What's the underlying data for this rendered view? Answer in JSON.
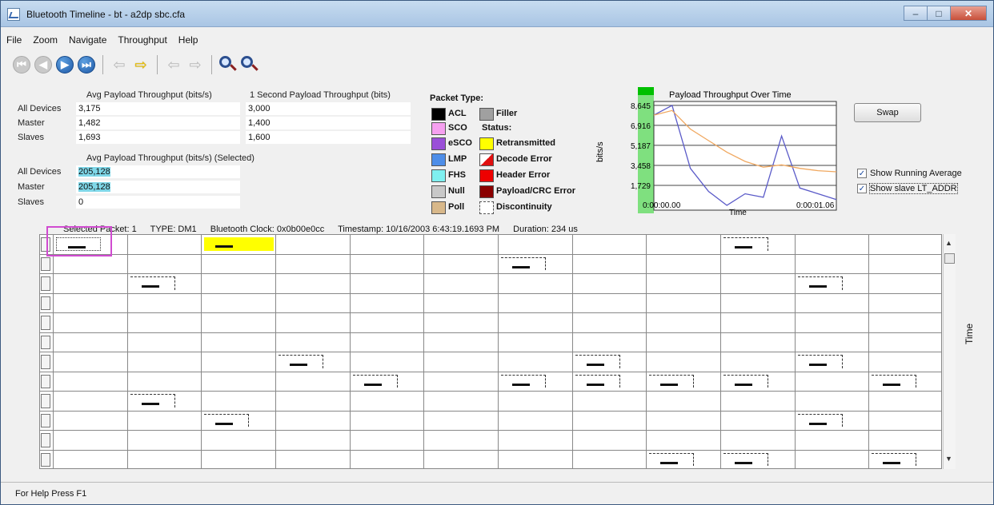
{
  "window": {
    "title": "Bluetooth Timeline - bt - a2dp sbc.cfa"
  },
  "menu": [
    "File",
    "Zoom",
    "Navigate",
    "Throughput",
    "Help"
  ],
  "toolbar": {
    "icons": [
      "first-icon",
      "prev-icon",
      "next-icon",
      "last-icon",
      "back-arrow-icon",
      "forward-arrow-icon",
      "back-arrow-icon",
      "forward-arrow-icon",
      "zoom-in-icon",
      "zoom-out-icon"
    ]
  },
  "throughput": {
    "avg_header": "Avg Payload Throughput (bits/s)",
    "sec_header": "1 Second Payload Throughput (bits)",
    "sel_header": "Avg Payload Throughput (bits/s) (Selected)",
    "rows": [
      {
        "label": "All Devices",
        "avg": "3,175",
        "sec": "3,000",
        "sel": "205,128"
      },
      {
        "label": "Master",
        "avg": "1,482",
        "sec": "1,400",
        "sel": "205,128"
      },
      {
        "label": "Slaves",
        "avg": "1,693",
        "sec": "1,600",
        "sel": "0"
      }
    ]
  },
  "legend": {
    "packet_type_title": "Packet Type:",
    "status_title": "Status:",
    "types": [
      {
        "label": "ACL",
        "color": "#000000"
      },
      {
        "label": "Filler",
        "color": "#a0a0a0"
      },
      {
        "label": "SCO",
        "color": "#f6a0f0"
      },
      {
        "label": "eSCO",
        "color": "#9a4fd8"
      },
      {
        "label": "LMP",
        "color": "#4e8ee8"
      },
      {
        "label": "FHS",
        "color": "#7ff0f0"
      },
      {
        "label": "Null",
        "color": "#c8c8c8"
      },
      {
        "label": "Poll",
        "color": "#d8b88a"
      }
    ],
    "statuses": [
      {
        "label": "Retransmitted",
        "color": "#ffff00"
      },
      {
        "label": "Decode Error",
        "color": "#e01010"
      },
      {
        "label": "Header Error",
        "color": "#ee0000"
      },
      {
        "label": "Payload/CRC Error",
        "color": "#8b0000"
      },
      {
        "label": "Discontinuity",
        "color": "#ffffff"
      }
    ]
  },
  "chart_data": {
    "type": "line",
    "title": "Payload Throughput Over Time",
    "ylabel": "bits/s",
    "xlabel": "Time",
    "yticks": [
      "8,645",
      "6,916",
      "5,187",
      "3,458",
      "1,729"
    ],
    "xticks": [
      "0:00:00.00",
      "0:00:01.06"
    ],
    "ylim": [
      0,
      8645
    ],
    "series": [
      {
        "color": "#5a5ac8",
        "x": [
          0,
          0.1,
          0.2,
          0.3,
          0.4,
          0.5,
          0.6,
          0.7,
          0.8,
          0.9,
          1.0
        ],
        "values": [
          7800,
          8645,
          3200,
          1200,
          0,
          1000,
          700,
          6000,
          1500,
          1000,
          500
        ]
      },
      {
        "color": "#f0a860",
        "x": [
          0,
          0.1,
          0.2,
          0.3,
          0.4,
          0.5,
          0.6,
          0.7,
          0.8,
          0.9,
          1.0
        ],
        "values": [
          7800,
          8200,
          6600,
          5600,
          4600,
          3800,
          3300,
          3500,
          3200,
          3000,
          2900
        ]
      }
    ]
  },
  "swap_label": "Swap",
  "options": {
    "show_running_average": "Show Running Average",
    "show_slave": "Show slave LT_ADDR"
  },
  "packet_info": {
    "selected": "Selected Packet: 1",
    "type": "TYPE: DM1",
    "clock": "Bluetooth Clock: 0x0b00e0cc",
    "timestamp": "Timestamp: 10/16/2003 6:43:19.1693 PM",
    "duration": "Duration: 234 us"
  },
  "timeline": {
    "rows": 12,
    "cols": 12,
    "time_label": "Time",
    "packets": [
      {
        "r": 0,
        "c": 0,
        "type": "sel"
      },
      {
        "r": 0,
        "c": 2,
        "type": "retx"
      },
      {
        "r": 0,
        "c": 9,
        "type": "box"
      },
      {
        "r": 1,
        "c": 6,
        "type": "box"
      },
      {
        "r": 2,
        "c": 1,
        "type": "box"
      },
      {
        "r": 2,
        "c": 10,
        "type": "box"
      },
      {
        "r": 6,
        "c": 3,
        "type": "box"
      },
      {
        "r": 6,
        "c": 7,
        "type": "box"
      },
      {
        "r": 6,
        "c": 10,
        "type": "box"
      },
      {
        "r": 7,
        "c": 4,
        "type": "box"
      },
      {
        "r": 7,
        "c": 6,
        "type": "box"
      },
      {
        "r": 7,
        "c": 7,
        "type": "box"
      },
      {
        "r": 7,
        "c": 8,
        "type": "box"
      },
      {
        "r": 7,
        "c": 9,
        "type": "box"
      },
      {
        "r": 7,
        "c": 11,
        "type": "box"
      },
      {
        "r": 8,
        "c": 1,
        "type": "box"
      },
      {
        "r": 9,
        "c": 2,
        "type": "box"
      },
      {
        "r": 9,
        "c": 10,
        "type": "box"
      },
      {
        "r": 11,
        "c": 8,
        "type": "box"
      },
      {
        "r": 11,
        "c": 9,
        "type": "box"
      },
      {
        "r": 11,
        "c": 11,
        "type": "box"
      }
    ]
  },
  "status_bar": {
    "text": "For Help Press F1"
  }
}
